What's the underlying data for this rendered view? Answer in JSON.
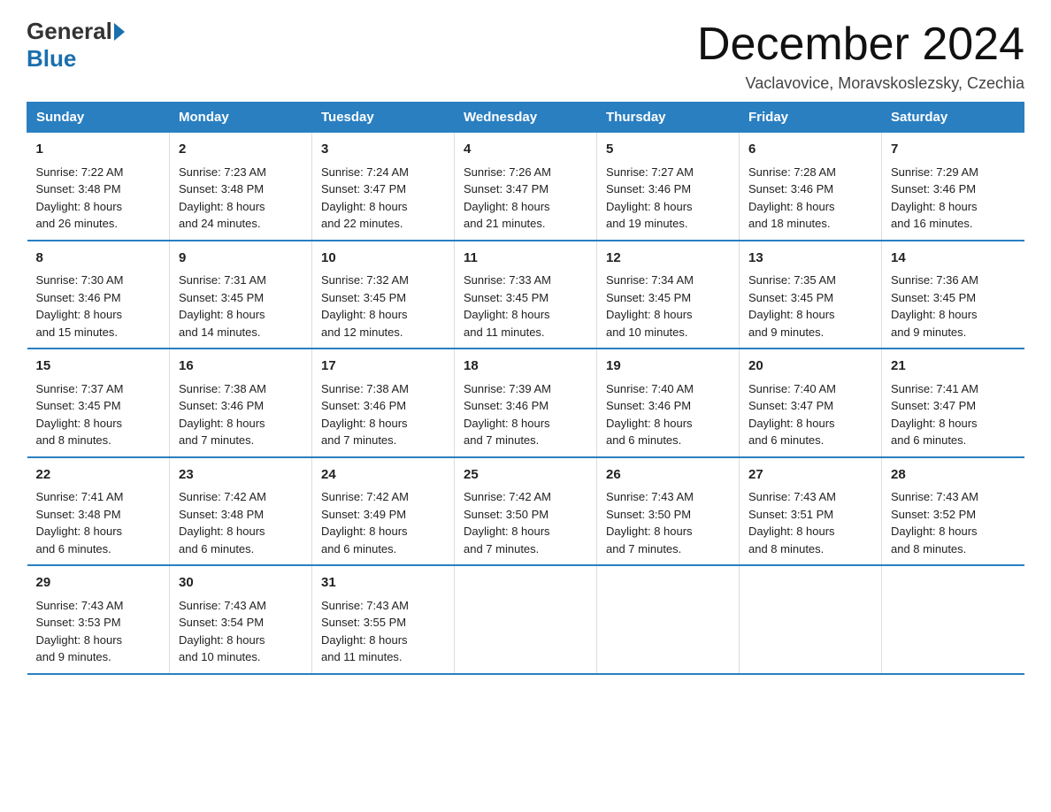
{
  "header": {
    "logo_general": "General",
    "logo_blue": "Blue",
    "month_title": "December 2024",
    "location": "Vaclavovice, Moravskoslezsky, Czechia"
  },
  "days_of_week": [
    "Sunday",
    "Monday",
    "Tuesday",
    "Wednesday",
    "Thursday",
    "Friday",
    "Saturday"
  ],
  "weeks": [
    [
      {
        "day": "1",
        "sunrise": "7:22 AM",
        "sunset": "3:48 PM",
        "daylight": "8 hours and 26 minutes."
      },
      {
        "day": "2",
        "sunrise": "7:23 AM",
        "sunset": "3:48 PM",
        "daylight": "8 hours and 24 minutes."
      },
      {
        "day": "3",
        "sunrise": "7:24 AM",
        "sunset": "3:47 PM",
        "daylight": "8 hours and 22 minutes."
      },
      {
        "day": "4",
        "sunrise": "7:26 AM",
        "sunset": "3:47 PM",
        "daylight": "8 hours and 21 minutes."
      },
      {
        "day": "5",
        "sunrise": "7:27 AM",
        "sunset": "3:46 PM",
        "daylight": "8 hours and 19 minutes."
      },
      {
        "day": "6",
        "sunrise": "7:28 AM",
        "sunset": "3:46 PM",
        "daylight": "8 hours and 18 minutes."
      },
      {
        "day": "7",
        "sunrise": "7:29 AM",
        "sunset": "3:46 PM",
        "daylight": "8 hours and 16 minutes."
      }
    ],
    [
      {
        "day": "8",
        "sunrise": "7:30 AM",
        "sunset": "3:46 PM",
        "daylight": "8 hours and 15 minutes."
      },
      {
        "day": "9",
        "sunrise": "7:31 AM",
        "sunset": "3:45 PM",
        "daylight": "8 hours and 14 minutes."
      },
      {
        "day": "10",
        "sunrise": "7:32 AM",
        "sunset": "3:45 PM",
        "daylight": "8 hours and 12 minutes."
      },
      {
        "day": "11",
        "sunrise": "7:33 AM",
        "sunset": "3:45 PM",
        "daylight": "8 hours and 11 minutes."
      },
      {
        "day": "12",
        "sunrise": "7:34 AM",
        "sunset": "3:45 PM",
        "daylight": "8 hours and 10 minutes."
      },
      {
        "day": "13",
        "sunrise": "7:35 AM",
        "sunset": "3:45 PM",
        "daylight": "8 hours and 9 minutes."
      },
      {
        "day": "14",
        "sunrise": "7:36 AM",
        "sunset": "3:45 PM",
        "daylight": "8 hours and 9 minutes."
      }
    ],
    [
      {
        "day": "15",
        "sunrise": "7:37 AM",
        "sunset": "3:45 PM",
        "daylight": "8 hours and 8 minutes."
      },
      {
        "day": "16",
        "sunrise": "7:38 AM",
        "sunset": "3:46 PM",
        "daylight": "8 hours and 7 minutes."
      },
      {
        "day": "17",
        "sunrise": "7:38 AM",
        "sunset": "3:46 PM",
        "daylight": "8 hours and 7 minutes."
      },
      {
        "day": "18",
        "sunrise": "7:39 AM",
        "sunset": "3:46 PM",
        "daylight": "8 hours and 7 minutes."
      },
      {
        "day": "19",
        "sunrise": "7:40 AM",
        "sunset": "3:46 PM",
        "daylight": "8 hours and 6 minutes."
      },
      {
        "day": "20",
        "sunrise": "7:40 AM",
        "sunset": "3:47 PM",
        "daylight": "8 hours and 6 minutes."
      },
      {
        "day": "21",
        "sunrise": "7:41 AM",
        "sunset": "3:47 PM",
        "daylight": "8 hours and 6 minutes."
      }
    ],
    [
      {
        "day": "22",
        "sunrise": "7:41 AM",
        "sunset": "3:48 PM",
        "daylight": "8 hours and 6 minutes."
      },
      {
        "day": "23",
        "sunrise": "7:42 AM",
        "sunset": "3:48 PM",
        "daylight": "8 hours and 6 minutes."
      },
      {
        "day": "24",
        "sunrise": "7:42 AM",
        "sunset": "3:49 PM",
        "daylight": "8 hours and 6 minutes."
      },
      {
        "day": "25",
        "sunrise": "7:42 AM",
        "sunset": "3:50 PM",
        "daylight": "8 hours and 7 minutes."
      },
      {
        "day": "26",
        "sunrise": "7:43 AM",
        "sunset": "3:50 PM",
        "daylight": "8 hours and 7 minutes."
      },
      {
        "day": "27",
        "sunrise": "7:43 AM",
        "sunset": "3:51 PM",
        "daylight": "8 hours and 8 minutes."
      },
      {
        "day": "28",
        "sunrise": "7:43 AM",
        "sunset": "3:52 PM",
        "daylight": "8 hours and 8 minutes."
      }
    ],
    [
      {
        "day": "29",
        "sunrise": "7:43 AM",
        "sunset": "3:53 PM",
        "daylight": "8 hours and 9 minutes."
      },
      {
        "day": "30",
        "sunrise": "7:43 AM",
        "sunset": "3:54 PM",
        "daylight": "8 hours and 10 minutes."
      },
      {
        "day": "31",
        "sunrise": "7:43 AM",
        "sunset": "3:55 PM",
        "daylight": "8 hours and 11 minutes."
      },
      null,
      null,
      null,
      null
    ]
  ],
  "labels": {
    "sunrise": "Sunrise:",
    "sunset": "Sunset:",
    "daylight": "Daylight:"
  }
}
